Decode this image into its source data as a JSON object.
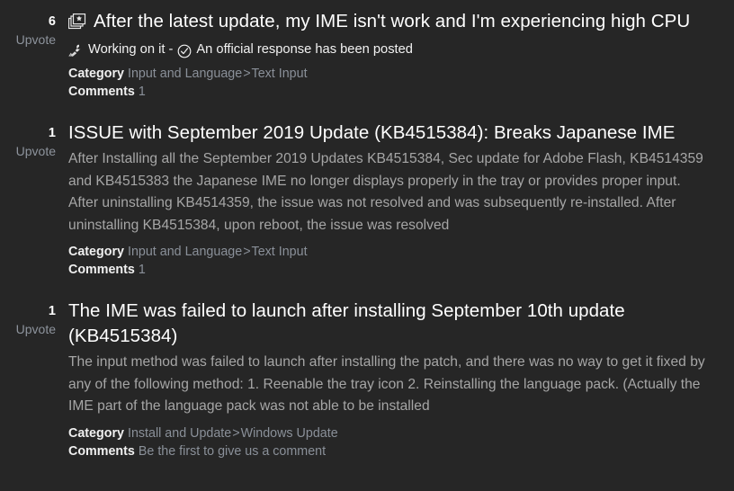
{
  "theme": {
    "background": "#262626",
    "title_color": "#ffffff",
    "snippet_color": "#a6a6a6",
    "link_color": "#8a9099",
    "upvote_label_color": "#8d939c",
    "meta_key_color": "#f0f0f0"
  },
  "labels": {
    "upvote": "Upvote",
    "category": "Category",
    "comments": "Comments",
    "separator": ">",
    "status_separator": "-"
  },
  "posts": [
    {
      "vote_count": "6",
      "upvote_label": "Upvote",
      "featured_icon": "featured-cards-star-icon",
      "title": "After the latest update, my IME isn't work and I'm experiencing high CPU",
      "has_status": true,
      "status_icon": "working-on-it-icon",
      "status_text": "Working on it",
      "status_separator": "-",
      "official_icon": "official-response-check-icon",
      "official_text": "An official response has been posted",
      "snippet": "",
      "category_label": "Category",
      "category_primary": "Input and Language",
      "category_separator": ">",
      "category_secondary": "Text Input",
      "comments_label": "Comments",
      "comments_value": "1"
    },
    {
      "vote_count": "1",
      "upvote_label": "Upvote",
      "featured_icon": "",
      "title": "ISSUE with September 2019 Update (KB4515384): Breaks Japanese IME",
      "has_status": false,
      "status_icon": "",
      "status_text": "",
      "status_separator": "",
      "official_icon": "",
      "official_text": "",
      "snippet": "After Installing all the September 2019 Updates KB4515384, Sec update for Adobe Flash, KB4514359 and KB4515383 the Japanese IME no longer displays properly in the tray or provides proper input. After uninstalling KB4514359, the issue was not resolved and was subsequently re-installed. After uninstalling KB4515384, upon reboot, the issue was resolved",
      "category_label": "Category",
      "category_primary": "Input and Language",
      "category_separator": ">",
      "category_secondary": "Text Input",
      "comments_label": "Comments",
      "comments_value": "1"
    },
    {
      "vote_count": "1",
      "upvote_label": "Upvote",
      "featured_icon": "",
      "title": "The IME was failed to launch after installing September 10th update (KB4515384)",
      "has_status": false,
      "status_icon": "",
      "status_text": "",
      "status_separator": "",
      "official_icon": "",
      "official_text": "",
      "snippet": "The input method was failed to launch after installing the patch, and there was no way to get it fixed by any of the following method: 1. Reenable the tray icon 2. Reinstalling the language pack. (Actually the IME part of the language pack was not able to be installed",
      "category_label": "Category",
      "category_primary": "Install and Update",
      "category_separator": ">",
      "category_secondary": "Windows Update",
      "comments_label": "Comments",
      "comments_value": "Be the first to give us a comment"
    }
  ]
}
